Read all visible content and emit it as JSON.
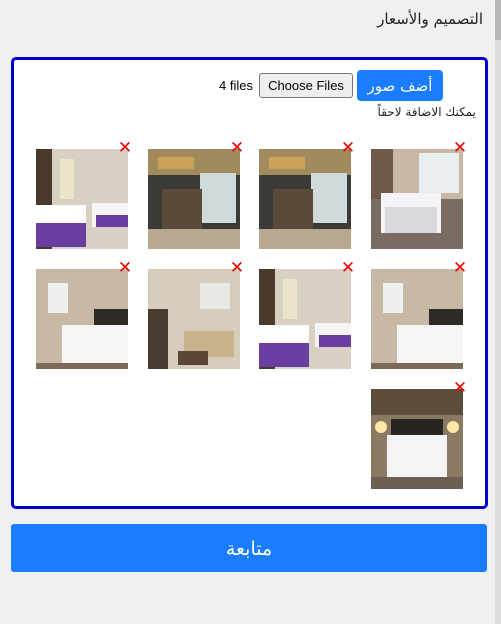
{
  "header": {
    "title": "التصميم والأسعار"
  },
  "upload": {
    "add_photos_label": "أضف صور",
    "choose_files_label": "Choose Files",
    "file_count_text": "4 files",
    "hint": "يمكنك الاضافة لاحقاً",
    "remove_symbol": "✕"
  },
  "thumbnails": [
    {
      "variant": "window-bed"
    },
    {
      "variant": "lobby-bar"
    },
    {
      "variant": "lobby-bar"
    },
    {
      "variant": "purple-bed"
    },
    {
      "variant": "bedroom-twin"
    },
    {
      "variant": "purple-bed"
    },
    {
      "variant": "living-room"
    },
    {
      "variant": "bedroom-twin"
    },
    {
      "variant": "bed-lamps"
    }
  ],
  "footer": {
    "continue_label": "متابعة"
  },
  "colors": {
    "accent": "#1a7cff",
    "border": "#0000cd",
    "remove": "#ee0000"
  }
}
